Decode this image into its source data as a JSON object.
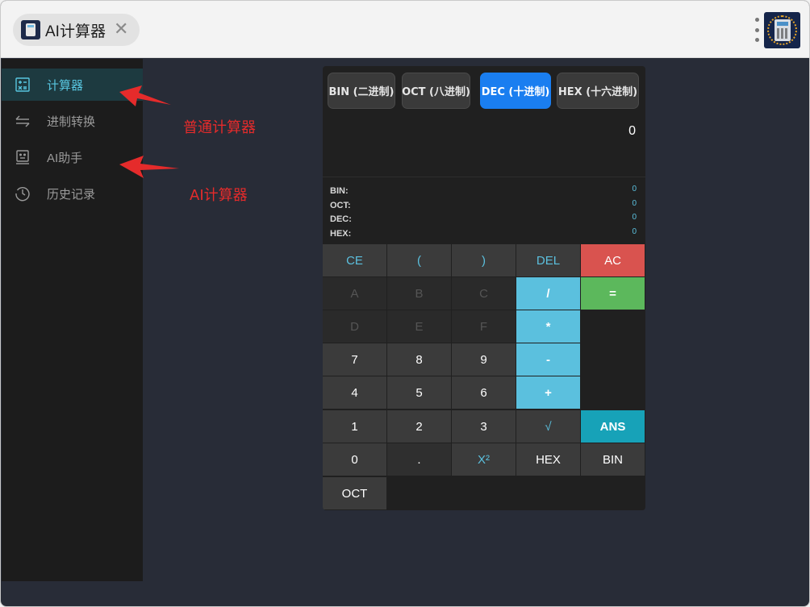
{
  "titlebar": {
    "tab_title": "AI计算器",
    "close_glyph": "✕",
    "tab_icon": "calculator-icon",
    "app_logo": "calculator-logo-icon"
  },
  "sidebar": {
    "items": [
      {
        "label": "计算器",
        "icon": "calculator-icon",
        "active": true
      },
      {
        "label": "进制转换",
        "icon": "swap-arrows-icon",
        "active": false
      },
      {
        "label": "AI助手",
        "icon": "robot-face-icon",
        "active": false
      },
      {
        "label": "历史记录",
        "icon": "history-clock-icon",
        "active": false
      }
    ]
  },
  "annotations": {
    "normal_calc": "普通计算器",
    "ai_calc": "AI计算器",
    "color": "#e52b2b"
  },
  "calculator": {
    "modes": [
      {
        "label": "BIN (二进制)",
        "active": false
      },
      {
        "label": "OCT (八进制)",
        "active": false
      },
      {
        "label": "DEC (十进制)",
        "active": true
      },
      {
        "label": "HEX (十六进制)",
        "active": false
      }
    ],
    "display_value": "0",
    "bases": [
      {
        "label": "BIN:",
        "value": "0"
      },
      {
        "label": "OCT:",
        "value": "0"
      },
      {
        "label": "DEC:",
        "value": "0"
      },
      {
        "label": "HEX:",
        "value": "0"
      }
    ],
    "keys": {
      "ce": "CE",
      "lparen": "(",
      "rparen": ")",
      "del": "DEL",
      "ac": "AC",
      "a": "A",
      "b": "B",
      "c": "C",
      "divide": "/",
      "equals": "=",
      "d": "D",
      "e": "E",
      "f": "F",
      "multiply": "*",
      "n7": "7",
      "n8": "8",
      "n9": "9",
      "minus": "-",
      "n4": "4",
      "n5": "5",
      "n6": "6",
      "plus": "+",
      "n1": "1",
      "n2": "2",
      "n3": "3",
      "sqrt": "√",
      "ans": "ANS",
      "n0": "0",
      "dot": ".",
      "square": "X²",
      "hex": "HEX",
      "bin": "BIN",
      "oct": "OCT"
    },
    "colors": {
      "accent": "#1a7ef0",
      "operator": "#5bc0de",
      "danger": "#d9534f",
      "equals": "#5cb85c",
      "ans": "#17a2b8"
    }
  }
}
